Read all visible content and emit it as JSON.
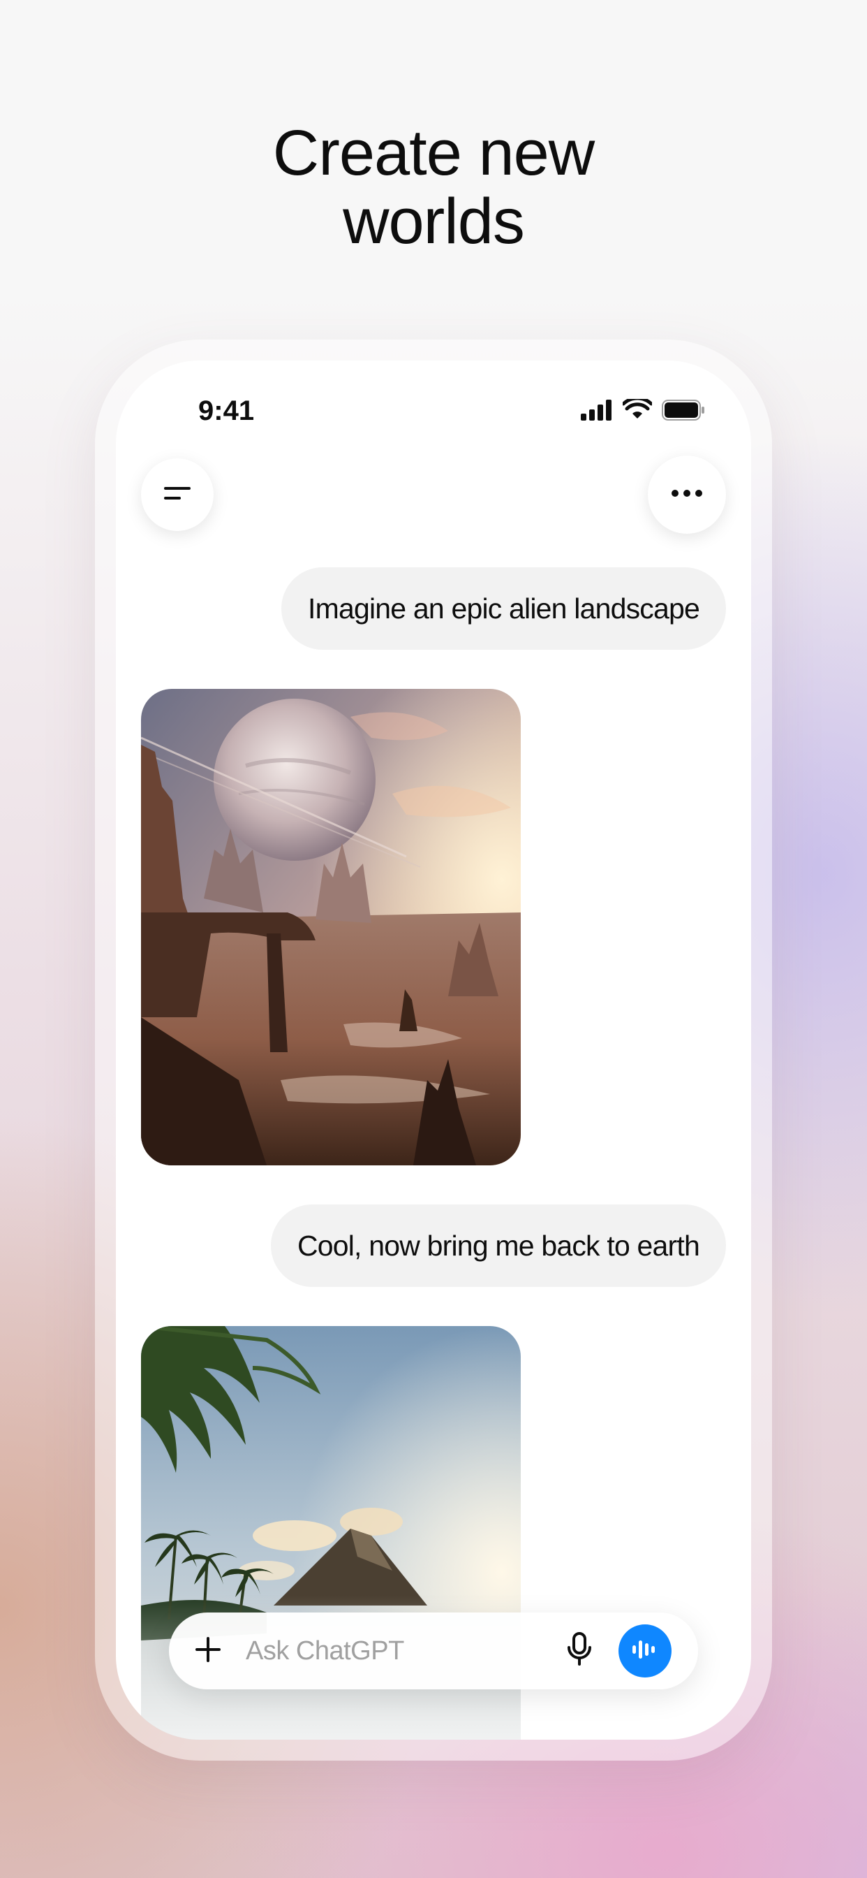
{
  "headline": {
    "line1": "Create new",
    "line2": "worlds"
  },
  "status_bar": {
    "time": "9:41",
    "icons": [
      "cellular-signal-icon",
      "wifi-icon",
      "battery-icon"
    ]
  },
  "header": {
    "menu_icon": "sidebar-menu-icon",
    "more_icon": "more-options-icon"
  },
  "conversation": {
    "messages": [
      {
        "role": "user",
        "text": "Imagine an epic alien landscape"
      },
      {
        "role": "assistant",
        "image": "alien-landscape-image"
      },
      {
        "role": "user",
        "text": "Cool, now bring me back to earth"
      },
      {
        "role": "assistant",
        "image": "tropical-beach-image"
      }
    ]
  },
  "composer": {
    "placeholder": "Ask ChatGPT",
    "add_icon": "plus-icon",
    "mic_icon": "microphone-icon",
    "voice_icon": "voice-mode-icon"
  },
  "colors": {
    "accent": "#0f87ff",
    "bubble": "#f2f2f2",
    "text": "#0d0d0d",
    "placeholder": "#a0a0a0"
  }
}
